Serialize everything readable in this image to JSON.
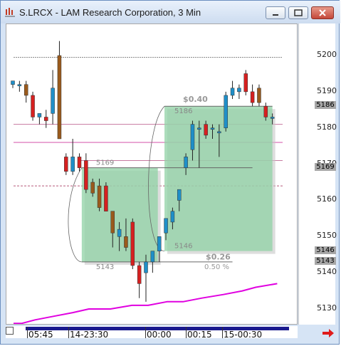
{
  "window": {
    "title": "S.LRCX - LAM Research Corporation, 3 Min"
  },
  "chart_data": {
    "type": "candlestick",
    "y_ticks": [
      "5200",
      "5190",
      "5180",
      "5170",
      "5160",
      "5150",
      "5140",
      "5130"
    ],
    "x_ticks": [
      "05:45",
      "14-23:30",
      "00:00",
      "00:15",
      "15-00:30"
    ],
    "price_markers": [
      "5186",
      "5169",
      "5146",
      "5143"
    ],
    "candles": [
      {
        "o": 5192,
        "h": 5193,
        "l": 5191,
        "c": 5193
      },
      {
        "o": 5192,
        "h": 5193,
        "l": 5190,
        "c": 5192
      },
      {
        "o": 5192,
        "h": 5193,
        "l": 5187,
        "c": 5189
      },
      {
        "o": 5189,
        "h": 5190,
        "l": 5182,
        "c": 5183
      },
      {
        "o": 5183,
        "h": 5184,
        "l": 5181,
        "c": 5184
      },
      {
        "o": 5183,
        "h": 5185,
        "l": 5180,
        "c": 5182
      },
      {
        "o": 5184,
        "h": 5196,
        "l": 5181,
        "c": 5191
      },
      {
        "o": 5200,
        "h": 5204,
        "l": 5177,
        "c": 5177
      },
      {
        "o": 5172,
        "h": 5173,
        "l": 5167,
        "c": 5168
      },
      {
        "o": 5168,
        "h": 5177,
        "l": 5167,
        "c": 5172
      },
      {
        "o": 5172,
        "h": 5173,
        "l": 5168,
        "c": 5169
      },
      {
        "o": 5171,
        "h": 5173,
        "l": 5162,
        "c": 5163
      },
      {
        "o": 5165,
        "h": 5166,
        "l": 5161,
        "c": 5162
      },
      {
        "o": 5164,
        "h": 5166,
        "l": 5157,
        "c": 5158
      },
      {
        "o": 5164,
        "h": 5165,
        "l": 5157,
        "c": 5157
      },
      {
        "o": 5157,
        "h": 5157,
        "l": 5147,
        "c": 5151
      },
      {
        "o": 5150,
        "h": 5154,
        "l": 5146,
        "c": 5152
      },
      {
        "o": 5150,
        "h": 5155,
        "l": 5146,
        "c": 5147
      },
      {
        "o": 5154,
        "h": 5155,
        "l": 5141,
        "c": 5142
      },
      {
        "o": 5142,
        "h": 5143,
        "l": 5133,
        "c": 5137
      },
      {
        "o": 5140,
        "h": 5145,
        "l": 5132,
        "c": 5143
      },
      {
        "o": 5143,
        "h": 5146,
        "l": 5140,
        "c": 5146
      },
      {
        "o": 5146,
        "h": 5150,
        "l": 5143,
        "c": 5150
      },
      {
        "o": 5151,
        "h": 5154,
        "l": 5149,
        "c": 5155
      },
      {
        "o": 5154,
        "h": 5158,
        "l": 5152,
        "c": 5157
      },
      {
        "o": 5160,
        "h": 5162,
        "l": 5157,
        "c": 5163
      },
      {
        "o": 5169,
        "h": 5173,
        "l": 5167,
        "c": 5172
      },
      {
        "o": 5174,
        "h": 5182,
        "l": 5171,
        "c": 5181
      },
      {
        "o": 5180,
        "h": 5182,
        "l": 5169,
        "c": 5180
      },
      {
        "o": 5181,
        "h": 5182,
        "l": 5177,
        "c": 5178
      },
      {
        "o": 5180,
        "h": 5181,
        "l": 5177,
        "c": 5180
      },
      {
        "o": 5179,
        "h": 5181,
        "l": 5172,
        "c": 5179
      },
      {
        "o": 5180,
        "h": 5190,
        "l": 5179,
        "c": 5189
      },
      {
        "o": 5189,
        "h": 5193,
        "l": 5188,
        "c": 5191
      },
      {
        "o": 5190,
        "h": 5192,
        "l": 5188,
        "c": 5191
      },
      {
        "o": 5195,
        "h": 5196,
        "l": 5189,
        "c": 5190
      },
      {
        "o": 5190,
        "h": 5192,
        "l": 5186,
        "c": 5187
      },
      {
        "o": 5191,
        "h": 5192,
        "l": 5186,
        "c": 5187
      },
      {
        "o": 5186,
        "h": 5187,
        "l": 5182,
        "c": 5183
      },
      {
        "o": 5183,
        "h": 5184,
        "l": 5181,
        "c": 5183
      }
    ],
    "annotations": {
      "box1_labels": [
        "5169",
        "5143"
      ],
      "box2_labels": [
        "5186",
        "5146"
      ],
      "box1_range": [
        5143,
        5169
      ],
      "box2_range": [
        5146,
        5186
      ],
      "move_up": "$0.40",
      "move_down": "$0.26",
      "percent": "0.50 %"
    },
    "lines": {
      "gray_top": 5199.5,
      "pink_1": 5181,
      "pink_2": 5171,
      "pink_3": 5176,
      "pink_4": 5164
    },
    "moving_average": [
      [
        0,
        5126
      ],
      [
        0.03,
        5126
      ],
      [
        0.08,
        5127
      ],
      [
        0.15,
        5128
      ],
      [
        0.22,
        5129
      ],
      [
        0.28,
        5130
      ],
      [
        0.36,
        5130
      ],
      [
        0.44,
        5131
      ],
      [
        0.5,
        5131
      ],
      [
        0.57,
        5132
      ],
      [
        0.63,
        5132
      ],
      [
        0.7,
        5133
      ],
      [
        0.78,
        5134
      ],
      [
        0.85,
        5135
      ],
      [
        0.9,
        5136
      ],
      [
        0.98,
        5137
      ]
    ]
  }
}
